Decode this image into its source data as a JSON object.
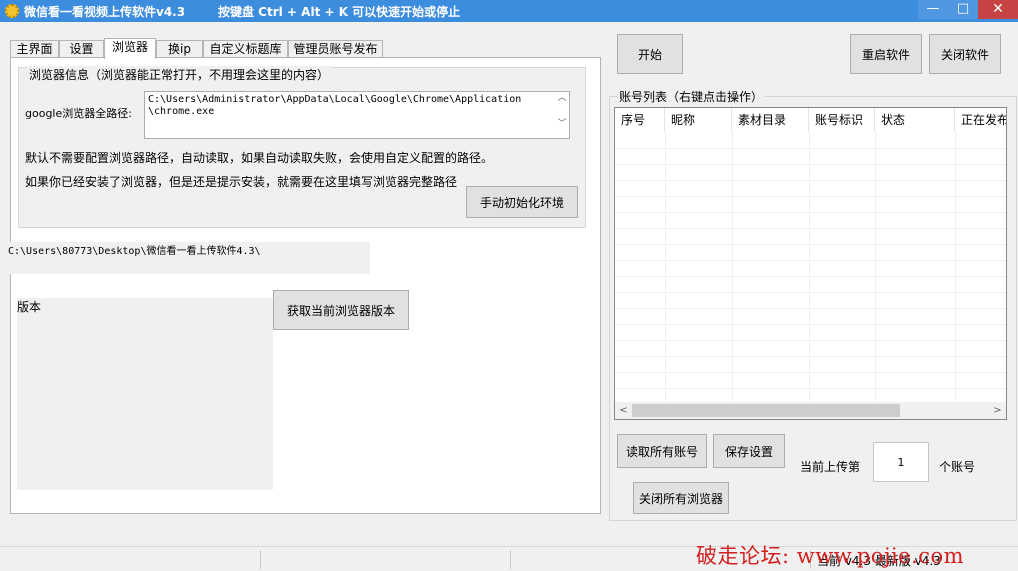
{
  "window": {
    "title": "微信看一看视频上传软件v4.3",
    "hint": "按键盘 Ctrl + Alt + K  可以快速开始或停止",
    "min_glyph": "—",
    "max_glyph": "□",
    "close_glyph": "✕"
  },
  "tabs": [
    "主界面",
    "设置",
    "浏览器",
    "换ip",
    "自定义标题库",
    "管理员账号发布"
  ],
  "browser_tab": {
    "group_title": "浏览器信息（浏览器能正常打开，不用理会这里的内容）",
    "path_label": "google浏览器全路径:",
    "path_value_line1": "C:\\Users\\Administrator\\AppData\\Local\\Google\\Chrome\\Application",
    "path_value_line2": "\\chrome.exe",
    "note1": "默认不需要配置浏览器路径，自动读取，如果自动读取失败，会使用自定义配置的路径。",
    "note2": "如果你已经安装了浏览器，但是还是提示安装，就需要在这里填写浏览器完整路径",
    "init_button": "手动初始化环境",
    "current_dir": "C:\\Users\\80773\\Desktop\\微信看一看上传软件4.3\\",
    "version_label": "版本",
    "get_version_button": "获取当前浏览器版本"
  },
  "top_buttons": {
    "start": "开始",
    "restart": "重启软件",
    "close": "关闭软件"
  },
  "accounts": {
    "group_title": "账号列表（右键点击操作）",
    "columns": [
      "序号",
      "昵称",
      "素材目录",
      "账号标识",
      "状态",
      "正在发布"
    ]
  },
  "bottom": {
    "read_accounts": "读取所有账号",
    "save_settings": "保存设置",
    "close_browsers": "关闭所有浏览器",
    "upload_prefix": "当前上传第",
    "upload_value": "1",
    "upload_suffix": "个账号"
  },
  "statusbar": {
    "text": "当前 v4.3 最新版 v4.3"
  },
  "watermark": "破走论坛: www.pojie.com"
}
